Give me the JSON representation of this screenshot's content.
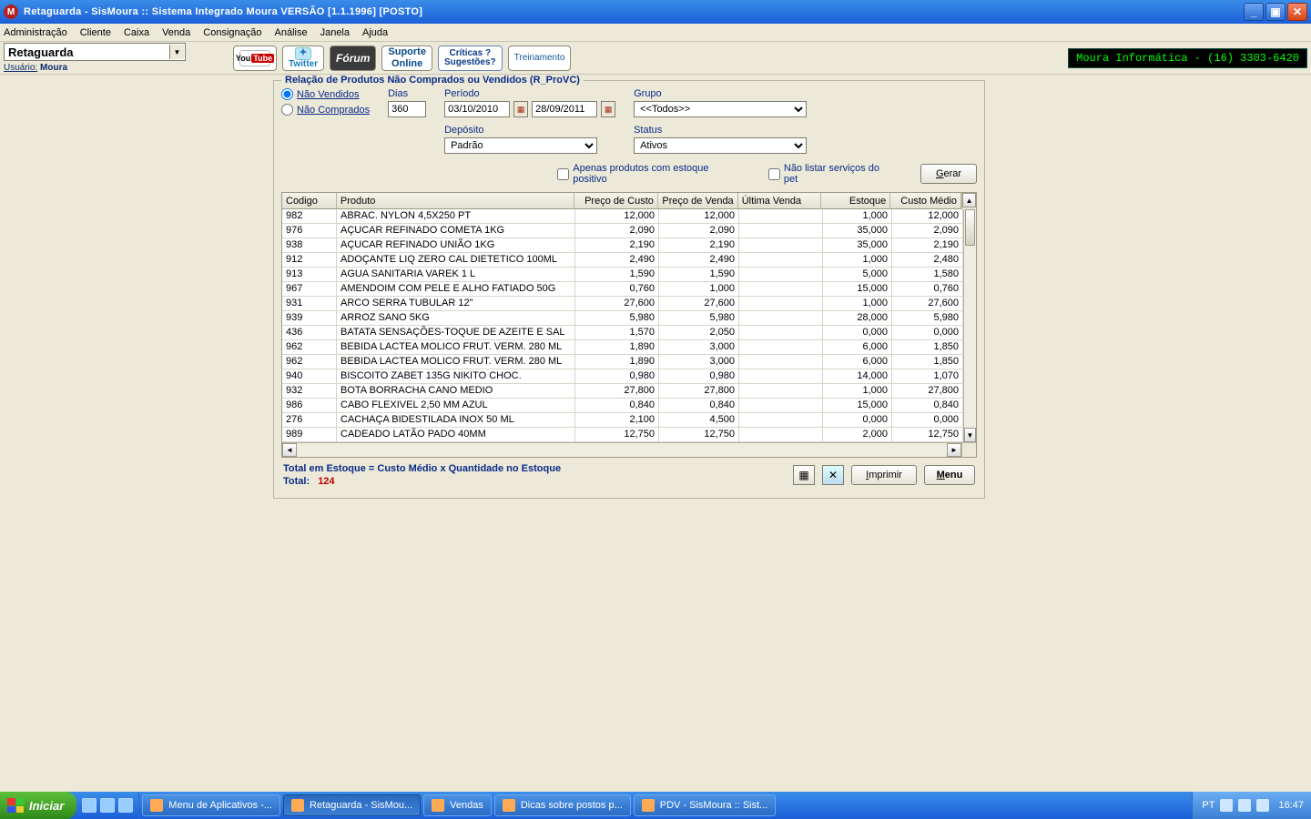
{
  "window": {
    "icon_letter": "M",
    "title": "Retaguarda - SisMoura :: Sistema Integrado Moura      VERSÃO [1.1.1996] [POSTO]"
  },
  "menubar": [
    "Administração",
    "Cliente",
    "Caixa",
    "Venda",
    "Consignação",
    "Análise",
    "Janela",
    "Ajuda"
  ],
  "combo_value": "Retaguarda",
  "user_label": "Usuário:",
  "user_value": "Moura",
  "toolbar": {
    "youtube_1": "You",
    "youtube_2": "Tube",
    "twitter": "Twitter",
    "forum": "Fórum",
    "suporte_1": "Suporte",
    "suporte_2": "Online",
    "criticas_1": "Críticas ?",
    "criticas_2": "Sugestões?",
    "treinamento": "Treinamento"
  },
  "phone_badge": "Moura Informática - (16) 3303-6420",
  "report": {
    "group_title": "Relação de Produtos Não Comprados ou Vendidos (R_ProVC)",
    "radio_nv": "Não Vendidos",
    "radio_nc": "Não Comprados",
    "lab_dias": "Dias",
    "val_dias": "360",
    "lab_periodo": "Período",
    "date_from": "03/10/2010",
    "date_to": "28/09/2011",
    "lab_grupo": "Grupo",
    "val_grupo": "<<Todos>>",
    "lab_deposito": "Depósito",
    "val_deposito": "Padrão",
    "lab_status": "Status",
    "val_status": "Ativos",
    "chk_estoque_pos": "Apenas produtos com estoque positivo",
    "chk_pet": "Não listar serviços do pet",
    "btn_gerar_u": "G",
    "btn_gerar_rest": "erar",
    "columns": {
      "codigo": "Codigo",
      "produto": "Produto",
      "preco_custo": "Preço de Custo",
      "preco_venda": "Preço de Venda",
      "ultima_venda": "Última Venda",
      "estoque": "Estoque",
      "custo_medio": "Custo Médio"
    },
    "rows": [
      {
        "codigo": "982",
        "produto": "ABRAC. NYLON 4,5X250 PT",
        "pc": "12,000",
        "pv": "12,000",
        "uv": "",
        "est": "1,000",
        "cm": "12,000"
      },
      {
        "codigo": "976",
        "produto": "AÇUCAR REFINADO COMETA 1KG",
        "pc": "2,090",
        "pv": "2,090",
        "uv": "",
        "est": "35,000",
        "cm": "2,090"
      },
      {
        "codigo": "938",
        "produto": "AÇUCAR REFINADO UNIÃO 1KG",
        "pc": "2,190",
        "pv": "2,190",
        "uv": "",
        "est": "35,000",
        "cm": "2,190"
      },
      {
        "codigo": "912",
        "produto": "ADOÇANTE LIQ ZERO CAL DIETETICO 100ML",
        "pc": "2,490",
        "pv": "2,490",
        "uv": "",
        "est": "1,000",
        "cm": "2,480"
      },
      {
        "codigo": "913",
        "produto": "AGUA SANITARIA VAREK 1 L",
        "pc": "1,590",
        "pv": "1,590",
        "uv": "",
        "est": "5,000",
        "cm": "1,580"
      },
      {
        "codigo": "967",
        "produto": "AMENDOIM COM PELE E ALHO FATIADO 50G",
        "pc": "0,760",
        "pv": "1,000",
        "uv": "",
        "est": "15,000",
        "cm": "0,760"
      },
      {
        "codigo": "931",
        "produto": "ARCO SERRA TUBULAR 12\"",
        "pc": "27,600",
        "pv": "27,600",
        "uv": "",
        "est": "1,000",
        "cm": "27,600"
      },
      {
        "codigo": "939",
        "produto": "ARROZ SANO 5KG",
        "pc": "5,980",
        "pv": "5,980",
        "uv": "",
        "est": "28,000",
        "cm": "5,980"
      },
      {
        "codigo": "436",
        "produto": "BATATA SENSAÇÕES-TOQUE DE AZEITE E SAL",
        "pc": "1,570",
        "pv": "2,050",
        "uv": "",
        "est": "0,000",
        "cm": "0,000"
      },
      {
        "codigo": "962",
        "produto": "BEBIDA LACTEA MOLICO FRUT. VERM. 280 ML",
        "pc": "1,890",
        "pv": "3,000",
        "uv": "",
        "est": "6,000",
        "cm": "1,850"
      },
      {
        "codigo": "962",
        "produto": "BEBIDA LACTEA MOLICO FRUT. VERM. 280 ML",
        "pc": "1,890",
        "pv": "3,000",
        "uv": "",
        "est": "6,000",
        "cm": "1,850"
      },
      {
        "codigo": "940",
        "produto": "BISCOITO ZABET 135G NIKITO CHOC.",
        "pc": "0,980",
        "pv": "0,980",
        "uv": "",
        "est": "14,000",
        "cm": "1,070"
      },
      {
        "codigo": "932",
        "produto": "BOTA BORRACHA CANO MEDIO",
        "pc": "27,800",
        "pv": "27,800",
        "uv": "",
        "est": "1,000",
        "cm": "27,800"
      },
      {
        "codigo": "986",
        "produto": "CABO FLEXIVEL 2,50 MM AZUL",
        "pc": "0,840",
        "pv": "0,840",
        "uv": "",
        "est": "15,000",
        "cm": "0,840"
      },
      {
        "codigo": "276",
        "produto": "CACHAÇA BIDESTILADA INOX 50 ML",
        "pc": "2,100",
        "pv": "4,500",
        "uv": "",
        "est": "0,000",
        "cm": "0,000"
      },
      {
        "codigo": "989",
        "produto": "CADEADO LATÃO PADO 40MM",
        "pc": "12,750",
        "pv": "12,750",
        "uv": "",
        "est": "2,000",
        "cm": "12,750"
      }
    ],
    "footer_note": "Total em Estoque = Custo Médio x Quantidade no Estoque",
    "total_label": "Total:",
    "total_value": "124",
    "btn_imprimir_u": "I",
    "btn_imprimir_rest": "mprimir",
    "btn_menu_u": "M",
    "btn_menu_rest": "enu"
  },
  "taskbar": {
    "start": "Iniciar",
    "tasks": [
      "Menu de Aplicativos -...",
      "Retaguarda - SisMou...",
      "Vendas",
      "Dicas sobre postos p...",
      "PDV - SisMoura :: Sist..."
    ],
    "lang": "PT",
    "clock": "16:47"
  }
}
